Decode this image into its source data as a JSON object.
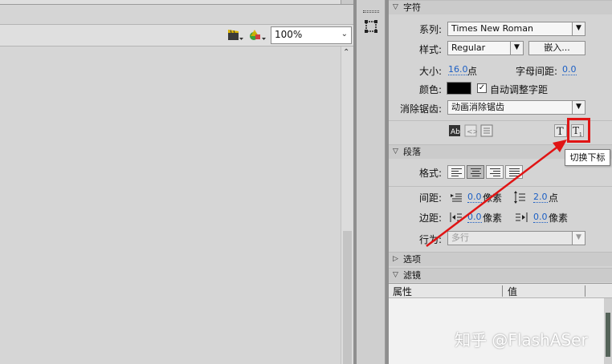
{
  "stage": {
    "zoom_value": "100%"
  },
  "panel": {
    "character": {
      "title": "字符",
      "family_label": "系列:",
      "family_value": "Times New Roman",
      "style_label": "样式:",
      "style_value": "Regular",
      "embed_button": "嵌入...",
      "size_label": "大小:",
      "size_value": "16.0",
      "size_unit": "点",
      "letter_spacing_label": "字母间距:",
      "letter_spacing_value": "0.0",
      "color_label": "颜色:",
      "color_value": "#000000",
      "auto_kern_label": "自动调整字距",
      "aa_label": "消除锯齿:",
      "aa_value": "动画消除锯齿"
    },
    "paragraph": {
      "title": "段落",
      "format_label": "格式:",
      "spacing_label": "间距:",
      "indent_value": "0.0",
      "indent_unit": "像素",
      "line_spacing_value": "2.0",
      "line_spacing_unit": "点",
      "margins_label": "边距:",
      "left_margin_value": "0.0",
      "left_margin_unit": "像素",
      "right_margin_value": "0.0",
      "right_margin_unit": "像素",
      "behavior_label": "行为:",
      "behavior_value": "多行"
    },
    "options": {
      "title": "选项"
    },
    "filters": {
      "title": "滤镜",
      "col_property": "属性",
      "col_value": "值"
    }
  },
  "tooltip": {
    "text": "切换下标"
  },
  "watermark": "知乎 @FlashASer",
  "colors": {
    "highlight": "#e01414",
    "link": "#1c5fc4"
  }
}
